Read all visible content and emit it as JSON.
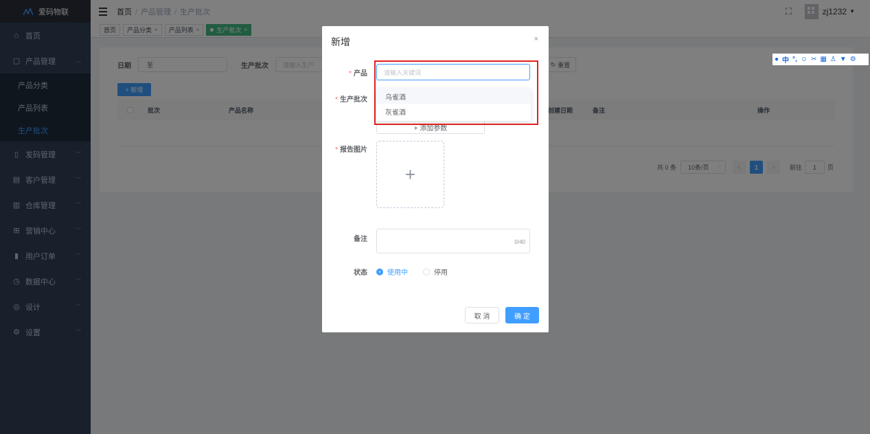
{
  "app": {
    "logo_text": "爱码物联"
  },
  "sidebar": {
    "items": [
      {
        "label": "首页",
        "icon": "home-icon"
      },
      {
        "label": "产品管理",
        "icon": "product-icon",
        "expanded": true,
        "children": [
          {
            "label": "产品分类"
          },
          {
            "label": "产品列表"
          },
          {
            "label": "生产批次",
            "active": true
          }
        ]
      },
      {
        "label": "发码管理",
        "icon": "code-icon"
      },
      {
        "label": "客户管理",
        "icon": "customer-icon"
      },
      {
        "label": "仓库管理",
        "icon": "warehouse-icon"
      },
      {
        "label": "营销中心",
        "icon": "marketing-icon"
      },
      {
        "label": "用户订单",
        "icon": "order-icon"
      },
      {
        "label": "数据中心",
        "icon": "data-icon"
      },
      {
        "label": "设计",
        "icon": "design-icon"
      },
      {
        "label": "设置",
        "icon": "settings-icon"
      }
    ]
  },
  "header": {
    "breadcrumb": [
      "首页",
      "产品管理",
      "生产批次"
    ],
    "username": "zj1232"
  },
  "tags": [
    {
      "label": "首页",
      "closable": false
    },
    {
      "label": "产品分类",
      "closable": true
    },
    {
      "label": "产品列表",
      "closable": true
    },
    {
      "label": "生产批次",
      "closable": true,
      "active": true
    }
  ],
  "filters": {
    "date_label": "日期",
    "date_separator": "至",
    "batch_label": "生产批次",
    "batch_placeholder": "请输入生产",
    "reset_label": "重置"
  },
  "toolbar": {
    "add_label": "+ 新增"
  },
  "table": {
    "columns": [
      "批次",
      "产品名称",
      "创建日期",
      "备注",
      "操作"
    ]
  },
  "pagination": {
    "total_text": "共 0 条",
    "page_size": "10条/页",
    "current_page": "1",
    "goto_label": "前往",
    "goto_value": "1",
    "page_suffix": "页",
    "prev": "<",
    "next": ">"
  },
  "dialog": {
    "title": "新增",
    "close": "×",
    "product_label": "产品",
    "product_placeholder": "请输入关键词",
    "product_options": [
      "乌雀酒",
      "灰雀酒"
    ],
    "batch_label": "生产批次",
    "add_param_label": "+ 添加参数",
    "report_label": "报告图片",
    "upload_plus": "+",
    "remark_label": "备注",
    "remark_count": "0/40",
    "status_label": "状态",
    "status_options": [
      "使用中",
      "停用"
    ],
    "status_selected": "使用中",
    "cancel_label": "取 消",
    "confirm_label": "确 定",
    "required_mark": "*"
  },
  "colors": {
    "sidebar_bg": "#304156",
    "primary": "#409eff",
    "active_tag": "#42b983",
    "highlight": "#e0201e"
  }
}
